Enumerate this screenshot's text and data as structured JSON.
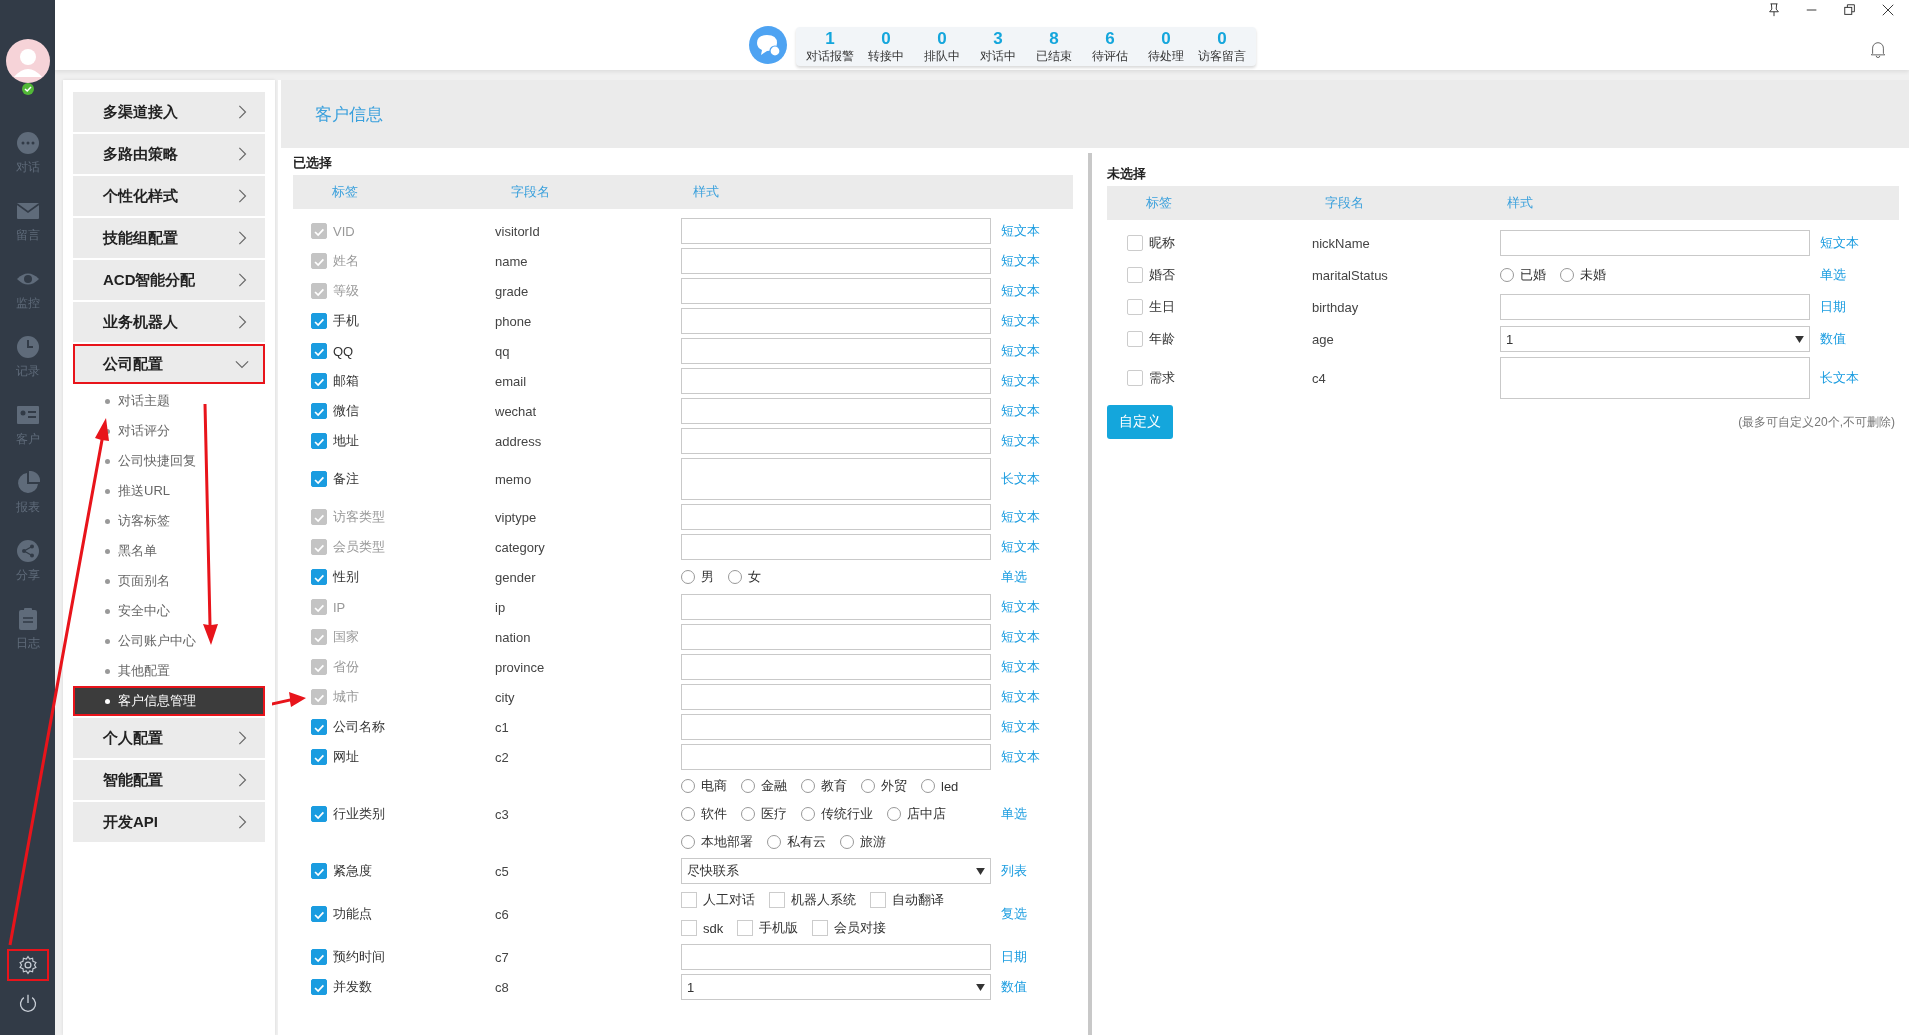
{
  "sidebar": {
    "online": true,
    "items": [
      {
        "label": "对话"
      },
      {
        "label": "留言"
      },
      {
        "label": "监控"
      },
      {
        "label": "记录"
      },
      {
        "label": "客户"
      },
      {
        "label": "报表"
      },
      {
        "label": "分享"
      },
      {
        "label": "日志"
      }
    ],
    "bottom_buttons": [
      {
        "highlighted": true
      },
      {
        "highlighted": false
      }
    ]
  },
  "stats": [
    {
      "value": "1",
      "label": "对话报警"
    },
    {
      "value": "0",
      "label": "转接中"
    },
    {
      "value": "0",
      "label": "排队中"
    },
    {
      "value": "3",
      "label": "对话中"
    },
    {
      "value": "8",
      "label": "已结束"
    },
    {
      "value": "6",
      "label": "待评估"
    },
    {
      "value": "0",
      "label": "待处理"
    },
    {
      "value": "0",
      "label": "访客留言"
    }
  ],
  "nav": {
    "items": [
      {
        "label": "多渠道接入",
        "expanded": false,
        "highlighted": false
      },
      {
        "label": "多路由策略",
        "expanded": false,
        "highlighted": false
      },
      {
        "label": "个性化样式",
        "expanded": false,
        "highlighted": false
      },
      {
        "label": "技能组配置",
        "expanded": false,
        "highlighted": false
      },
      {
        "label": "ACD智能分配",
        "expanded": false,
        "highlighted": false
      },
      {
        "label": "业务机器人",
        "expanded": false,
        "highlighted": false
      },
      {
        "label": "公司配置",
        "expanded": true,
        "highlighted": true,
        "children": [
          {
            "label": "对话主题",
            "selected": false,
            "highlighted": false
          },
          {
            "label": "对话评分",
            "selected": false,
            "highlighted": false
          },
          {
            "label": "公司快捷回复",
            "selected": false,
            "highlighted": false
          },
          {
            "label": "推送URL",
            "selected": false,
            "highlighted": false
          },
          {
            "label": "访客标签",
            "selected": false,
            "highlighted": false
          },
          {
            "label": "黑名单",
            "selected": false,
            "highlighted": false
          },
          {
            "label": "页面别名",
            "selected": false,
            "highlighted": false
          },
          {
            "label": "安全中心",
            "selected": false,
            "highlighted": false
          },
          {
            "label": "公司账户中心",
            "selected": false,
            "highlighted": false
          },
          {
            "label": "其他配置",
            "selected": false,
            "highlighted": false
          },
          {
            "label": "客户信息管理",
            "selected": true,
            "highlighted": true
          }
        ]
      },
      {
        "label": "个人配置",
        "expanded": false,
        "highlighted": false
      },
      {
        "label": "智能配置",
        "expanded": false,
        "highlighted": false
      },
      {
        "label": "开发API",
        "expanded": false,
        "highlighted": false
      }
    ]
  },
  "page_title": "客户信息",
  "selected_panel": {
    "title": "已选择",
    "columns": [
      "标签",
      "字段名",
      "样式"
    ],
    "rows": [
      {
        "label": "VID",
        "field": "visitorId",
        "checked": true,
        "disabled": true,
        "kind": "text",
        "style": "短文本"
      },
      {
        "label": "姓名",
        "field": "name",
        "checked": true,
        "disabled": true,
        "kind": "text",
        "style": "短文本"
      },
      {
        "label": "等级",
        "field": "grade",
        "checked": true,
        "disabled": true,
        "kind": "text",
        "style": "短文本"
      },
      {
        "label": "手机",
        "field": "phone",
        "checked": true,
        "disabled": false,
        "kind": "text",
        "style": "短文本"
      },
      {
        "label": "QQ",
        "field": "qq",
        "checked": true,
        "disabled": false,
        "kind": "text",
        "style": "短文本"
      },
      {
        "label": "邮箱",
        "field": "email",
        "checked": true,
        "disabled": false,
        "kind": "text",
        "style": "短文本"
      },
      {
        "label": "微信",
        "field": "wechat",
        "checked": true,
        "disabled": false,
        "kind": "text",
        "style": "短文本"
      },
      {
        "label": "地址",
        "field": "address",
        "checked": true,
        "disabled": false,
        "kind": "text",
        "style": "短文本"
      },
      {
        "label": "备注",
        "field": "memo",
        "checked": true,
        "disabled": false,
        "kind": "textarea",
        "style": "长文本"
      },
      {
        "label": "访客类型",
        "field": "viptype",
        "checked": true,
        "disabled": true,
        "kind": "text",
        "style": "短文本"
      },
      {
        "label": "会员类型",
        "field": "category",
        "checked": true,
        "disabled": true,
        "kind": "text",
        "style": "短文本"
      },
      {
        "label": "性别",
        "field": "gender",
        "checked": true,
        "disabled": false,
        "kind": "radio",
        "style": "单选",
        "lines": [
          [
            {
              "label": "男",
              "selected": false
            },
            {
              "label": "女",
              "selected": false
            }
          ]
        ]
      },
      {
        "label": "IP",
        "field": "ip",
        "checked": true,
        "disabled": true,
        "kind": "text",
        "style": "短文本"
      },
      {
        "label": "国家",
        "field": "nation",
        "checked": true,
        "disabled": true,
        "kind": "text",
        "style": "短文本"
      },
      {
        "label": "省份",
        "field": "province",
        "checked": true,
        "disabled": true,
        "kind": "text",
        "style": "短文本"
      },
      {
        "label": "城市",
        "field": "city",
        "checked": true,
        "disabled": true,
        "kind": "text",
        "style": "短文本"
      },
      {
        "label": "公司名称",
        "field": "c1",
        "checked": true,
        "disabled": false,
        "kind": "text",
        "style": "短文本"
      },
      {
        "label": "网址",
        "field": "c2",
        "checked": true,
        "disabled": false,
        "kind": "text",
        "style": "短文本"
      },
      {
        "label": "行业类别",
        "field": "c3",
        "checked": true,
        "disabled": false,
        "kind": "radio",
        "style": "单选",
        "lines": [
          [
            {
              "label": "电商",
              "selected": false
            },
            {
              "label": "金融",
              "selected": false
            },
            {
              "label": "教育",
              "selected": false
            },
            {
              "label": "外贸",
              "selected": false
            },
            {
              "label": "led",
              "selected": false
            }
          ],
          [
            {
              "label": "软件",
              "selected": false
            },
            {
              "label": "医疗",
              "selected": false
            },
            {
              "label": "传统行业",
              "selected": false
            },
            {
              "label": "店中店",
              "selected": false
            }
          ],
          [
            {
              "label": "本地部署",
              "selected": false
            },
            {
              "label": "私有云",
              "selected": false
            },
            {
              "label": "旅游",
              "selected": false
            }
          ]
        ]
      },
      {
        "label": "紧急度",
        "field": "c5",
        "checked": true,
        "disabled": false,
        "kind": "select",
        "style": "列表",
        "value": "尽快联系"
      },
      {
        "label": "功能点",
        "field": "c6",
        "checked": true,
        "disabled": false,
        "kind": "checkbox",
        "style": "复选",
        "lines": [
          [
            {
              "label": "人工对话",
              "checked": false
            },
            {
              "label": "机器人系统",
              "checked": false
            },
            {
              "label": "自动翻译",
              "checked": false
            }
          ],
          [
            {
              "label": "sdk",
              "checked": false
            },
            {
              "label": "手机版",
              "checked": false
            },
            {
              "label": "会员对接",
              "checked": false
            }
          ]
        ]
      },
      {
        "label": "预约时间",
        "field": "c7",
        "checked": true,
        "disabled": false,
        "kind": "text",
        "style": "日期"
      },
      {
        "label": "并发数",
        "field": "c8",
        "checked": true,
        "disabled": false,
        "kind": "select",
        "style": "数值",
        "value": "1"
      }
    ]
  },
  "unselected_panel": {
    "title": "未选择",
    "columns": [
      "标签",
      "字段名",
      "样式"
    ],
    "rows": [
      {
        "label": "昵称",
        "field": "nickName",
        "checked": false,
        "disabled": false,
        "kind": "text",
        "style": "短文本"
      },
      {
        "label": "婚否",
        "field": "maritalStatus",
        "checked": false,
        "disabled": false,
        "kind": "radio",
        "style": "单选",
        "lines": [
          [
            {
              "label": "已婚",
              "selected": false
            },
            {
              "label": "未婚",
              "selected": false
            }
          ]
        ]
      },
      {
        "label": "生日",
        "field": "birthday",
        "checked": false,
        "disabled": false,
        "kind": "text",
        "style": "日期"
      },
      {
        "label": "年龄",
        "field": "age",
        "checked": false,
        "disabled": false,
        "kind": "select",
        "style": "数值",
        "value": "1"
      },
      {
        "label": "需求",
        "field": "c4",
        "checked": false,
        "disabled": false,
        "kind": "textarea",
        "style": "长文本"
      }
    ],
    "button": "自定义",
    "note": "(最多可自定义20个,不可删除)"
  }
}
